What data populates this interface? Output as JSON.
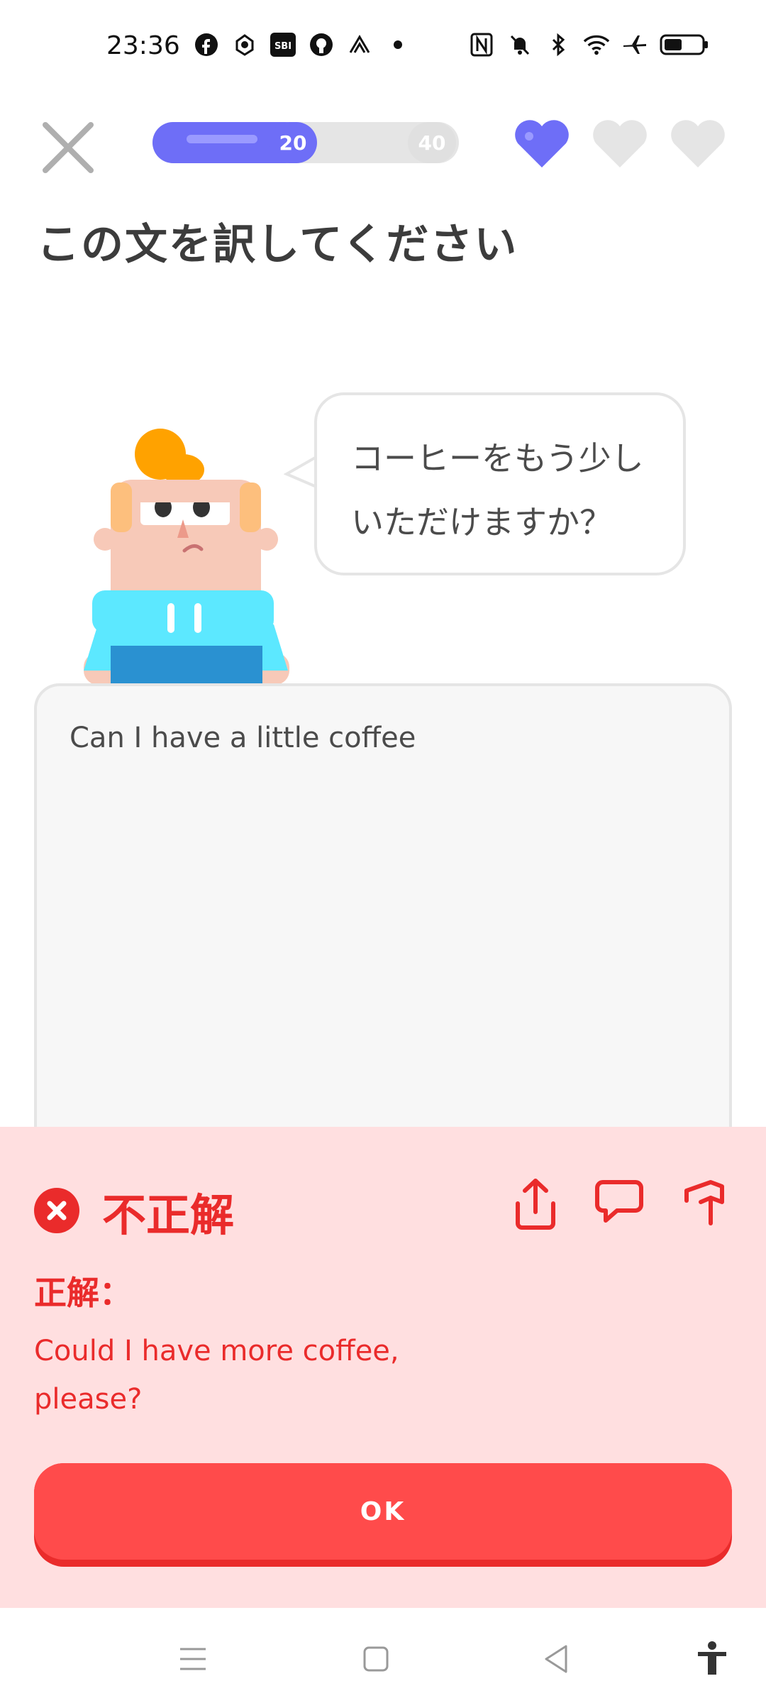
{
  "status_bar": {
    "time": "23:36",
    "left_icons": [
      "facebook-icon",
      "app-icon",
      "sbi-icon",
      "github-icon",
      "app-icon-2",
      "dot-icon"
    ],
    "right_icons": [
      "nfc-icon",
      "mute-icon",
      "bluetooth-icon",
      "wifi-icon",
      "airplane-icon",
      "battery-icon"
    ],
    "sbi_text": "SBI"
  },
  "lesson": {
    "progress_fraction": 0.5,
    "milestones": [
      "20",
      "40"
    ],
    "hearts_total": 3,
    "hearts_active": 1,
    "instruction": "この文を訳してください"
  },
  "prompt": {
    "line1": "コーヒーをもう少し",
    "line2": "いただけますか？"
  },
  "answer": {
    "user_text": "Can I have a little coffee"
  },
  "feedback": {
    "title": "不正解",
    "correct_label": "正解：",
    "correct_answer_line1": "Could I have more coffee,",
    "correct_answer_line2": "please?",
    "ok_label": "OK"
  },
  "colors": {
    "accent": "#6e6ef7",
    "error": "#ea2b2b",
    "error_bg": "#ffdfe0",
    "button": "#ff4b4b"
  },
  "navbar": {
    "items": [
      "menu-icon",
      "home-square-icon",
      "back-triangle-icon",
      "accessibility-icon"
    ]
  }
}
